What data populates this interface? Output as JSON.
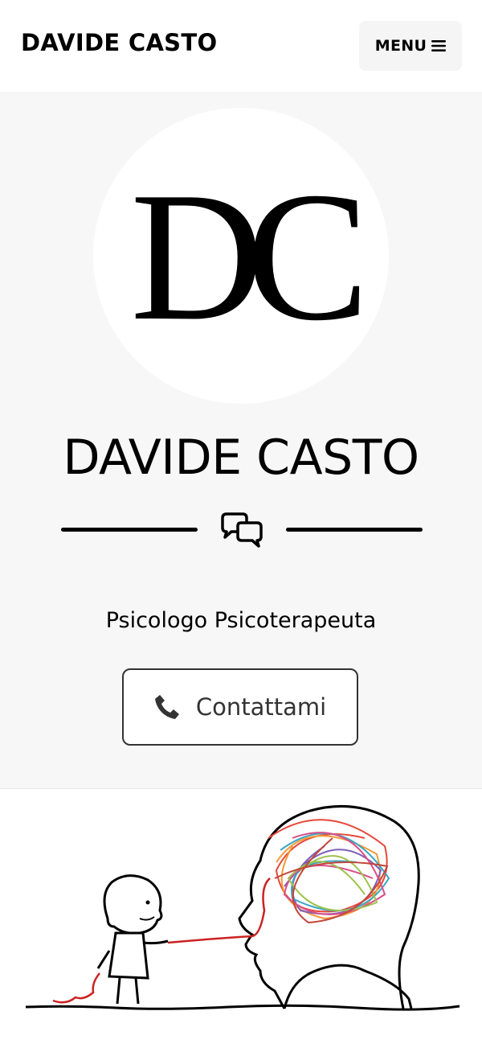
{
  "header": {
    "brand": "DAVIDE CASTO",
    "menu_label": "MENU",
    "menu_icon": "hamburger-icon"
  },
  "hero": {
    "logo_monogram": "DC",
    "title": "DAVIDE CASTO",
    "divider_icon": "comments-icon",
    "subtitle": "Psicologo Psicoterapeuta",
    "cta_label": "Contattami",
    "cta_icon": "phone-icon"
  },
  "illustration": {
    "subject": "cartoon-therapist-untangling-brain"
  },
  "colors": {
    "text": "#000000",
    "masthead_bg": "#f7f7f7",
    "button_border": "#333333",
    "menu_bg": "#f5f5f5"
  }
}
